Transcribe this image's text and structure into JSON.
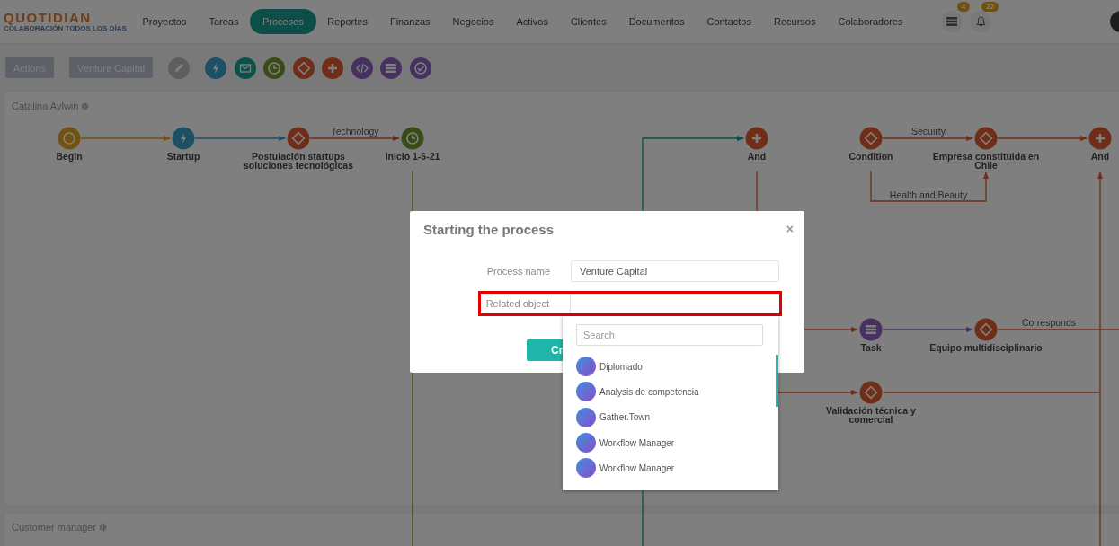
{
  "header": {
    "logo": "QUOTIDIAN",
    "tagline": "COLABORACIÓN TODOS LOS DÍAS",
    "nav": [
      {
        "label": "Proyectos",
        "selected": false
      },
      {
        "label": "Tareas",
        "selected": false
      },
      {
        "label": "Procesos",
        "selected": true
      },
      {
        "label": "Reportes",
        "selected": false
      },
      {
        "label": "Finanzas",
        "selected": false
      },
      {
        "label": "Negocios",
        "selected": false
      },
      {
        "label": "Activos",
        "selected": false
      },
      {
        "label": "Clientes",
        "selected": false
      },
      {
        "label": "Documentos",
        "selected": false
      },
      {
        "label": "Contactos",
        "selected": false
      },
      {
        "label": "Recursos",
        "selected": false
      },
      {
        "label": "Colaboradores",
        "selected": false
      }
    ],
    "notifications": [
      {
        "kind": "list",
        "count": "4"
      },
      {
        "kind": "bell",
        "count": "22"
      }
    ]
  },
  "toolbar": {
    "buttons": [
      "Actions",
      "Venture Capital"
    ],
    "tools": [
      {
        "kind": "edit"
      },
      {
        "kind": "trigger"
      },
      {
        "kind": "mail"
      },
      {
        "kind": "timer"
      },
      {
        "kind": "condition"
      },
      {
        "kind": "and"
      },
      {
        "kind": "code"
      },
      {
        "kind": "task"
      },
      {
        "kind": "approve"
      }
    ]
  },
  "lanes": [
    {
      "title": "Catalina Aylwin"
    },
    {
      "title": "Customer manager"
    }
  ],
  "diagram": {
    "nodes": [
      {
        "kind": "start",
        "label": "Begin"
      },
      {
        "kind": "trigger",
        "label": "Startup"
      },
      {
        "kind": "condition",
        "label": "Postulación startups soluciones tecnológicas"
      },
      {
        "kind": "timer",
        "label": "Inicio 1-6-21"
      },
      {
        "kind": "and",
        "label": "And"
      },
      {
        "kind": "condition",
        "label": "Condition"
      },
      {
        "kind": "condition",
        "label": "Empresa constituida en Chile"
      },
      {
        "kind": "and",
        "label": "And"
      },
      {
        "kind": "task",
        "label": "Task"
      },
      {
        "kind": "condition",
        "label": "Equipo multidisciplinario"
      },
      {
        "kind": "condition",
        "label": "Validación técnica y comercial"
      }
    ],
    "edge_labels": [
      "Technology",
      "Secuirty",
      "Health and Beauty",
      "Corresponds"
    ]
  },
  "modal": {
    "title": "Starting the process",
    "close": "×",
    "fields": [
      {
        "label": "Process name",
        "value": "Venture Capital",
        "highlighted": false
      },
      {
        "label": "Related object",
        "highlighted": true
      }
    ],
    "button": "Cr",
    "dropdown": {
      "placeholder": "Search",
      "items": [
        "Diplomado",
        "Analysis de competencia",
        "Gather.Town",
        "Workflow Manager",
        "Workflow Manager"
      ]
    }
  }
}
